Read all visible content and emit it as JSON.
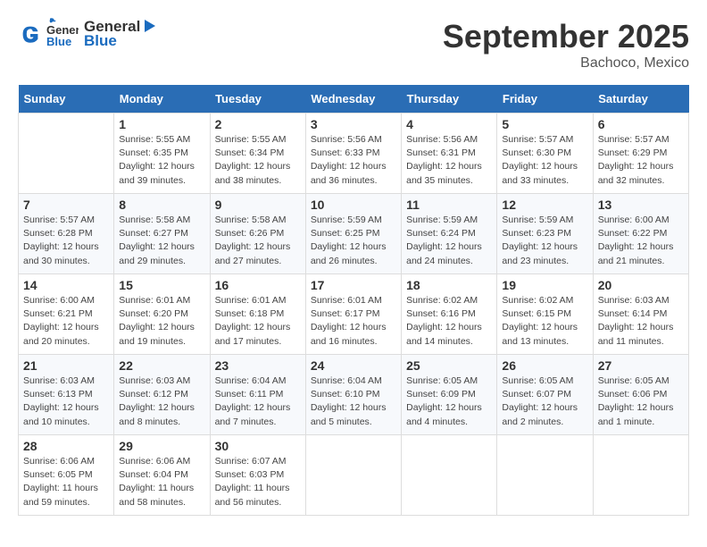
{
  "header": {
    "logo_general": "General",
    "logo_blue": "Blue",
    "month_title": "September 2025",
    "location": "Bachoco, Mexico"
  },
  "days_of_week": [
    "Sunday",
    "Monday",
    "Tuesday",
    "Wednesday",
    "Thursday",
    "Friday",
    "Saturday"
  ],
  "weeks": [
    [
      {
        "day": "",
        "info": ""
      },
      {
        "day": "1",
        "info": "Sunrise: 5:55 AM\nSunset: 6:35 PM\nDaylight: 12 hours\nand 39 minutes."
      },
      {
        "day": "2",
        "info": "Sunrise: 5:55 AM\nSunset: 6:34 PM\nDaylight: 12 hours\nand 38 minutes."
      },
      {
        "day": "3",
        "info": "Sunrise: 5:56 AM\nSunset: 6:33 PM\nDaylight: 12 hours\nand 36 minutes."
      },
      {
        "day": "4",
        "info": "Sunrise: 5:56 AM\nSunset: 6:31 PM\nDaylight: 12 hours\nand 35 minutes."
      },
      {
        "day": "5",
        "info": "Sunrise: 5:57 AM\nSunset: 6:30 PM\nDaylight: 12 hours\nand 33 minutes."
      },
      {
        "day": "6",
        "info": "Sunrise: 5:57 AM\nSunset: 6:29 PM\nDaylight: 12 hours\nand 32 minutes."
      }
    ],
    [
      {
        "day": "7",
        "info": "Sunrise: 5:57 AM\nSunset: 6:28 PM\nDaylight: 12 hours\nand 30 minutes."
      },
      {
        "day": "8",
        "info": "Sunrise: 5:58 AM\nSunset: 6:27 PM\nDaylight: 12 hours\nand 29 minutes."
      },
      {
        "day": "9",
        "info": "Sunrise: 5:58 AM\nSunset: 6:26 PM\nDaylight: 12 hours\nand 27 minutes."
      },
      {
        "day": "10",
        "info": "Sunrise: 5:59 AM\nSunset: 6:25 PM\nDaylight: 12 hours\nand 26 minutes."
      },
      {
        "day": "11",
        "info": "Sunrise: 5:59 AM\nSunset: 6:24 PM\nDaylight: 12 hours\nand 24 minutes."
      },
      {
        "day": "12",
        "info": "Sunrise: 5:59 AM\nSunset: 6:23 PM\nDaylight: 12 hours\nand 23 minutes."
      },
      {
        "day": "13",
        "info": "Sunrise: 6:00 AM\nSunset: 6:22 PM\nDaylight: 12 hours\nand 21 minutes."
      }
    ],
    [
      {
        "day": "14",
        "info": "Sunrise: 6:00 AM\nSunset: 6:21 PM\nDaylight: 12 hours\nand 20 minutes."
      },
      {
        "day": "15",
        "info": "Sunrise: 6:01 AM\nSunset: 6:20 PM\nDaylight: 12 hours\nand 19 minutes."
      },
      {
        "day": "16",
        "info": "Sunrise: 6:01 AM\nSunset: 6:18 PM\nDaylight: 12 hours\nand 17 minutes."
      },
      {
        "day": "17",
        "info": "Sunrise: 6:01 AM\nSunset: 6:17 PM\nDaylight: 12 hours\nand 16 minutes."
      },
      {
        "day": "18",
        "info": "Sunrise: 6:02 AM\nSunset: 6:16 PM\nDaylight: 12 hours\nand 14 minutes."
      },
      {
        "day": "19",
        "info": "Sunrise: 6:02 AM\nSunset: 6:15 PM\nDaylight: 12 hours\nand 13 minutes."
      },
      {
        "day": "20",
        "info": "Sunrise: 6:03 AM\nSunset: 6:14 PM\nDaylight: 12 hours\nand 11 minutes."
      }
    ],
    [
      {
        "day": "21",
        "info": "Sunrise: 6:03 AM\nSunset: 6:13 PM\nDaylight: 12 hours\nand 10 minutes."
      },
      {
        "day": "22",
        "info": "Sunrise: 6:03 AM\nSunset: 6:12 PM\nDaylight: 12 hours\nand 8 minutes."
      },
      {
        "day": "23",
        "info": "Sunrise: 6:04 AM\nSunset: 6:11 PM\nDaylight: 12 hours\nand 7 minutes."
      },
      {
        "day": "24",
        "info": "Sunrise: 6:04 AM\nSunset: 6:10 PM\nDaylight: 12 hours\nand 5 minutes."
      },
      {
        "day": "25",
        "info": "Sunrise: 6:05 AM\nSunset: 6:09 PM\nDaylight: 12 hours\nand 4 minutes."
      },
      {
        "day": "26",
        "info": "Sunrise: 6:05 AM\nSunset: 6:07 PM\nDaylight: 12 hours\nand 2 minutes."
      },
      {
        "day": "27",
        "info": "Sunrise: 6:05 AM\nSunset: 6:06 PM\nDaylight: 12 hours\nand 1 minute."
      }
    ],
    [
      {
        "day": "28",
        "info": "Sunrise: 6:06 AM\nSunset: 6:05 PM\nDaylight: 11 hours\nand 59 minutes."
      },
      {
        "day": "29",
        "info": "Sunrise: 6:06 AM\nSunset: 6:04 PM\nDaylight: 11 hours\nand 58 minutes."
      },
      {
        "day": "30",
        "info": "Sunrise: 6:07 AM\nSunset: 6:03 PM\nDaylight: 11 hours\nand 56 minutes."
      },
      {
        "day": "",
        "info": ""
      },
      {
        "day": "",
        "info": ""
      },
      {
        "day": "",
        "info": ""
      },
      {
        "day": "",
        "info": ""
      }
    ]
  ]
}
